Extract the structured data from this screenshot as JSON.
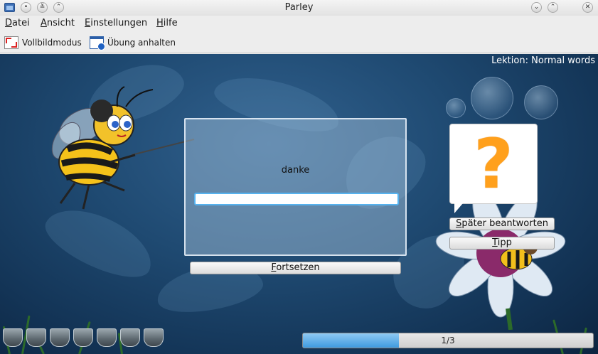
{
  "window": {
    "title": "Parley"
  },
  "menu": [
    "Datei",
    "Ansicht",
    "Einstellungen",
    "Hilfe"
  ],
  "toolbar": {
    "fullscreen_label": "Vollbildmodus",
    "pause_label": "Übung anhalten"
  },
  "practice": {
    "lesson_label": "Lektion: Normal words",
    "question": "danke",
    "answer_value": "",
    "continue_button": "Fortsetzen",
    "answer_later_button": "Später beantworten",
    "hint_button": "Tipp",
    "hint_mark": "?",
    "progress_text": "1/3",
    "progress_fraction": 0.33,
    "cups_count": 7
  },
  "colors": {
    "accent": "#56b2ee",
    "question_mark": "#ffa01c",
    "progress_fill": "#3f9adf"
  }
}
